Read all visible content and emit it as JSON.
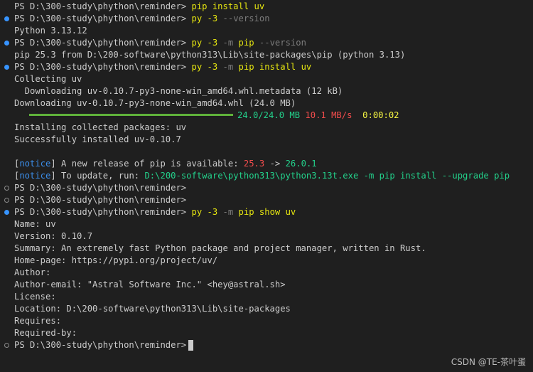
{
  "terminal": {
    "l1": {
      "prompt": "PS D:\\300-study\\phython\\reminder> ",
      "cmd": "pip install uv"
    },
    "l2": {
      "prompt": "PS D:\\300-study\\phython\\reminder> ",
      "cmd": "py -3 ",
      "arg": "--version"
    },
    "l3": {
      "text": "Python 3.13.12"
    },
    "l4": {
      "prompt": "PS D:\\300-study\\phython\\reminder> ",
      "cmd": "py -3 ",
      "flag": "-m",
      "cmd2": " pip ",
      "arg": "--version"
    },
    "l5": {
      "text": "pip 25.3 from D:\\200-software\\python313\\Lib\\site-packages\\pip (python 3.13)"
    },
    "l6": {
      "prompt": "PS D:\\300-study\\phython\\reminder> ",
      "cmd": "py -3 ",
      "flag": "-m",
      "cmd2": " pip install uv"
    },
    "l7": {
      "text": "Collecting uv"
    },
    "l8": {
      "text": "  Downloading uv-0.10.7-py3-none-win_amd64.whl.metadata (12 kB)"
    },
    "l9": {
      "text": "Downloading uv-0.10.7-py3-none-win_amd64.whl (24.0 MB)"
    },
    "l10": {
      "size": "24.0/24.0 MB",
      "speed": "10.1 MB/s",
      "eta": "0:00:02",
      "progress": 1.0
    },
    "l11": {
      "text": "Installing collected packages: uv"
    },
    "l12": {
      "text": "Successfully installed uv-0.10.7"
    },
    "l14": {
      "lb": "[",
      "tag": "notice",
      "rb": "]",
      "text": " A new release of pip is available: ",
      "old": "25.3",
      "arrow": " -> ",
      "new": "26.0.1"
    },
    "l15": {
      "lb": "[",
      "tag": "notice",
      "rb": "]",
      "text": " To update, run: ",
      "cmd": "D:\\200-software\\python313\\python3.13t.exe -m pip install --upgrade pip"
    },
    "l16": {
      "prompt": "PS D:\\300-study\\phython\\reminder>"
    },
    "l17": {
      "prompt": "PS D:\\300-study\\phython\\reminder>"
    },
    "l18": {
      "prompt": "PS D:\\300-study\\phython\\reminder> ",
      "cmd": "py -3 ",
      "flag": "-m",
      "cmd2": " pip show uv"
    },
    "l19": {
      "text": "Name: uv"
    },
    "l20": {
      "text": "Version: 0.10.7"
    },
    "l21": {
      "text": "Summary: An extremely fast Python package and project manager, written in Rust."
    },
    "l22": {
      "text": "Home-page: https://pypi.org/project/uv/"
    },
    "l23": {
      "text": "Author:"
    },
    "l24": {
      "text": "Author-email: \"Astral Software Inc.\" <hey@astral.sh>"
    },
    "l25": {
      "text": "License:"
    },
    "l26": {
      "text": "Location: D:\\200-software\\python313\\Lib\\site-packages"
    },
    "l27": {
      "text": "Requires:"
    },
    "l28": {
      "text": "Required-by:"
    },
    "l29": {
      "prompt": "PS D:\\300-study\\phython\\reminder>"
    }
  },
  "watermark": "CSDN @TE-茶叶蛋",
  "colors": {
    "background": "#1f1f1f",
    "command": "#e5e510",
    "dim": "#7c7c7c",
    "green": "#23d18b",
    "red": "#f14c4c",
    "notice": "#3b8eea",
    "decoration_ok": "#3794ff"
  }
}
